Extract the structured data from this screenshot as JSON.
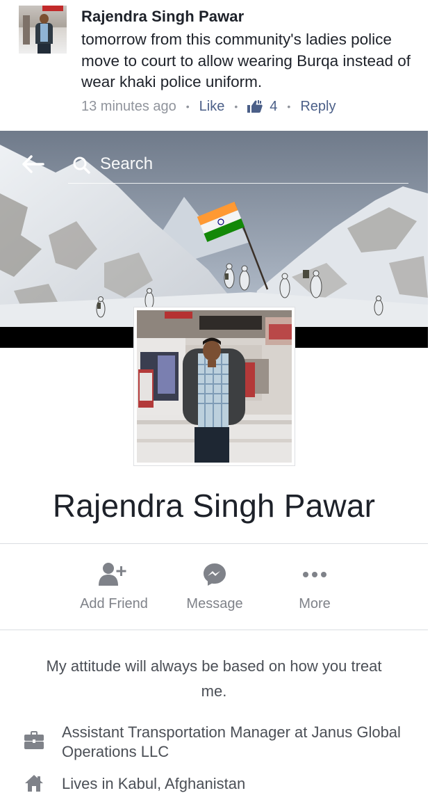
{
  "comment": {
    "author": "Rajendra Singh Pawar",
    "text": "tomorrow from this community's ladies police move to court to allow  wearing Burqa instead of wear khaki police uniform.",
    "time": "13 minutes ago",
    "like_label": "Like",
    "like_count": "4",
    "reply_label": "Reply",
    "icons": {
      "avatar": "user-photo",
      "likes": "thumbs-up-icon"
    }
  },
  "header": {
    "search_placeholder": "Search",
    "icons": {
      "back": "back-arrow-icon",
      "search": "search-icon"
    }
  },
  "profile": {
    "name": "Rajendra Singh Pawar"
  },
  "actions": [
    {
      "label": "Add Friend",
      "icon": "add-friend-icon"
    },
    {
      "label": "Message",
      "icon": "messenger-icon"
    },
    {
      "label": "More",
      "icon": "more-dots-icon"
    }
  ],
  "bio": "My attitude will always be based on how you treat me.",
  "info": [
    {
      "icon": "briefcase-icon",
      "text": "Assistant Transportation Manager at Janus Global Operations LLC"
    },
    {
      "icon": "home-icon",
      "text": "Lives in Kabul, Afghanistan"
    }
  ],
  "colors": {
    "link": "#4b5f88",
    "meta_gray": "#90949c",
    "icon_gray": "#7f8289",
    "text_dark": "#1d2129",
    "flag_saffron": "#ff9933",
    "flag_green": "#138808"
  }
}
